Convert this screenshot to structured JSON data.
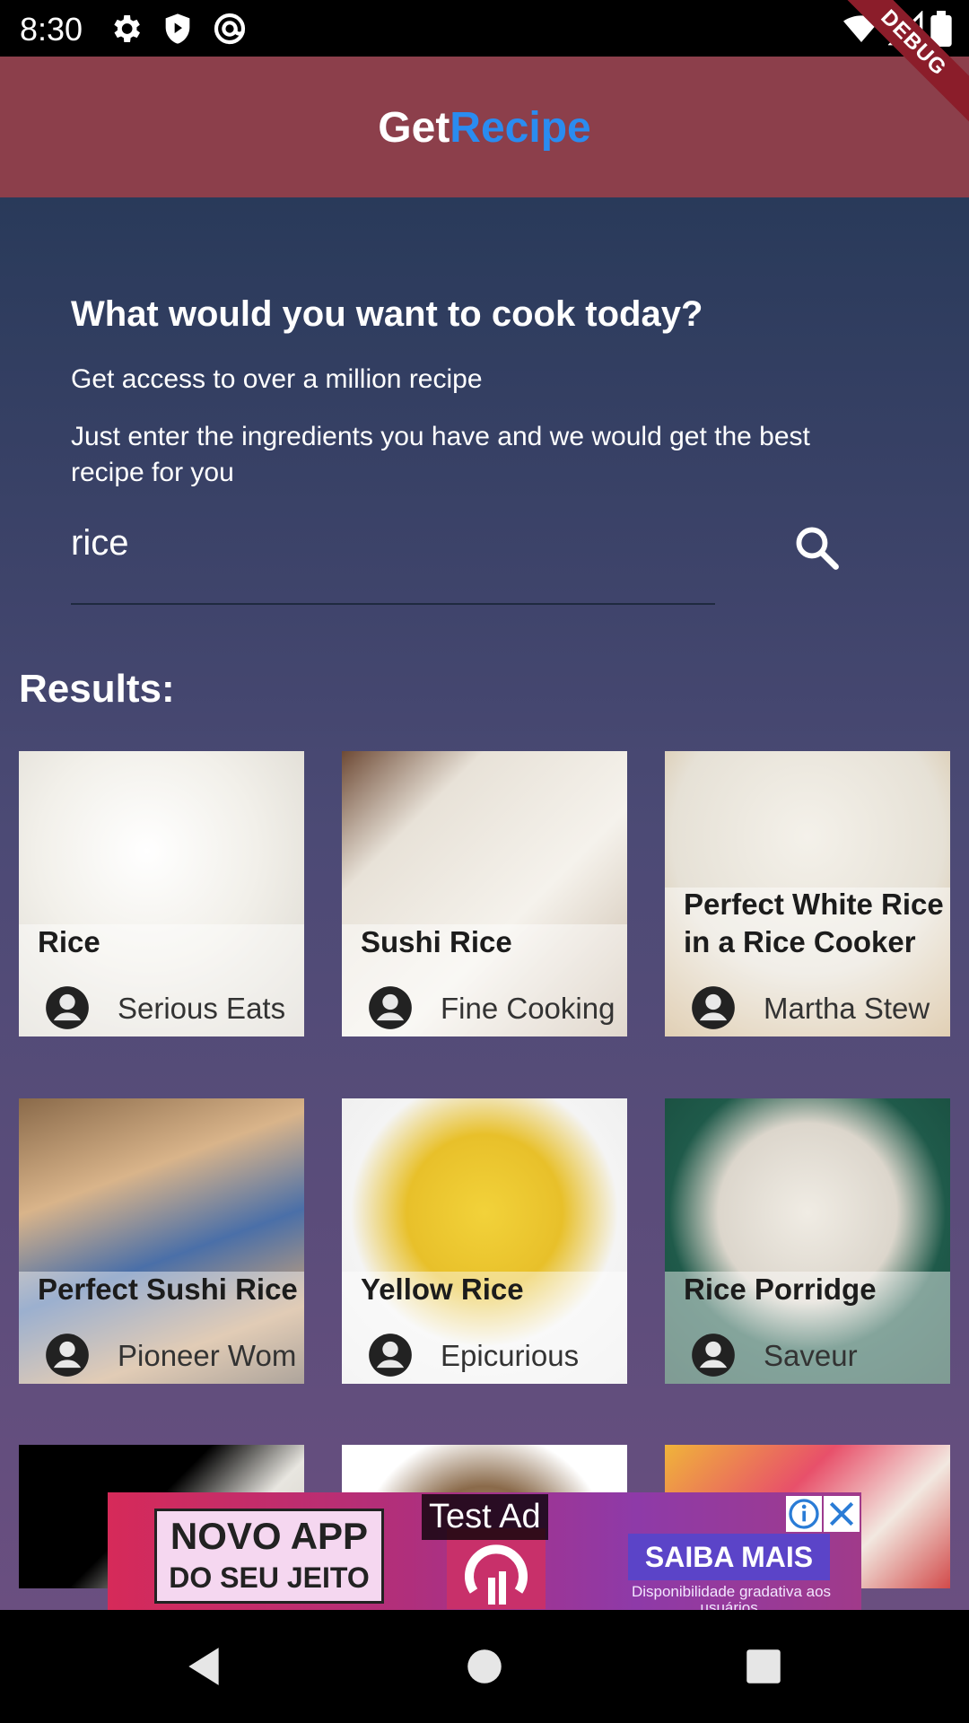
{
  "status_bar": {
    "time": "8:30",
    "icons": [
      "settings-icon",
      "shield-icon",
      "at-sign-icon",
      "wifi-icon",
      "signal-icon",
      "battery-icon"
    ],
    "debug_label": "DEBUG"
  },
  "app_bar": {
    "title_part1": "Get",
    "title_part2": "Recipe",
    "colors": {
      "background": "#8c3f4b",
      "title_part1": "#ffffff",
      "title_part2": "#2a8cf0"
    }
  },
  "main": {
    "headline": "What would you want to cook today?",
    "subtext1": "Get access to over a million recipe",
    "subtext2": "Just enter the ingredients you have and we would get the best recipe for you",
    "search": {
      "value": "rice",
      "icon": "search-icon"
    },
    "results_label": "Results:",
    "recipes": [
      {
        "title": "Rice",
        "source": "Serious Eats"
      },
      {
        "title": "Sushi Rice",
        "source": "Fine Cooking"
      },
      {
        "title": "Perfect White Rice in a Rice Cooker",
        "source": "Martha Stew"
      },
      {
        "title": "Perfect Sushi Rice",
        "source": "Pioneer Wom"
      },
      {
        "title": "Yellow Rice",
        "source": "Epicurious"
      },
      {
        "title": "Rice Porridge",
        "source": "Saveur"
      }
    ]
  },
  "ad": {
    "test_label": "Test Ad",
    "box_line1": "NOVO APP",
    "box_line2": "DO SEU JEITO",
    "cta": "SAIBA MAIS",
    "disclaimer": "Disponibilidade gradativa aos usuários."
  },
  "nav_bar": {
    "icons": [
      "back-icon",
      "home-icon",
      "recents-icon"
    ]
  }
}
